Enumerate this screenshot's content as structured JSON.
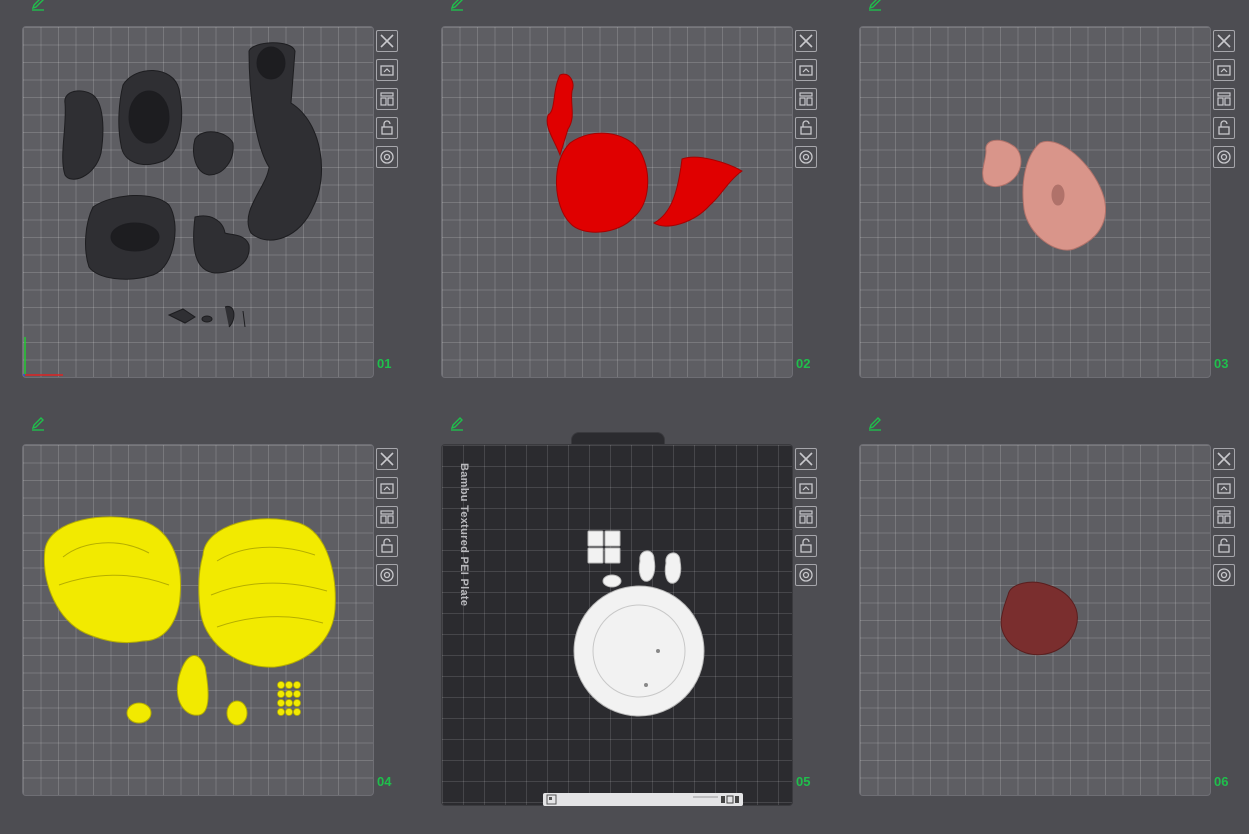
{
  "plates": [
    {
      "number": "01",
      "icon": "pencil-icon"
    },
    {
      "number": "02",
      "icon": "pencil-icon"
    },
    {
      "number": "03",
      "icon": "pencil-icon"
    },
    {
      "number": "04",
      "icon": "pencil-icon"
    },
    {
      "number": "05",
      "icon": "pencil-icon",
      "plate_type": "Bambu Textured PEI Plate"
    },
    {
      "number": "06",
      "icon": "pencil-icon"
    }
  ],
  "toolbar_icons": [
    "close-icon",
    "auto-orient-icon",
    "arrange-icon",
    "lock-icon",
    "settings-icon"
  ],
  "colors": {
    "background": "#4d4d52",
    "plate": "#5e5e63",
    "label_green": "#1fbf4c",
    "filament_black": "#2f2f33",
    "filament_red": "#e00000",
    "filament_skin": "#d9958a",
    "filament_yellow": "#f2ea00",
    "filament_white": "#f2f2f2",
    "filament_maroon": "#7a2e2e"
  }
}
